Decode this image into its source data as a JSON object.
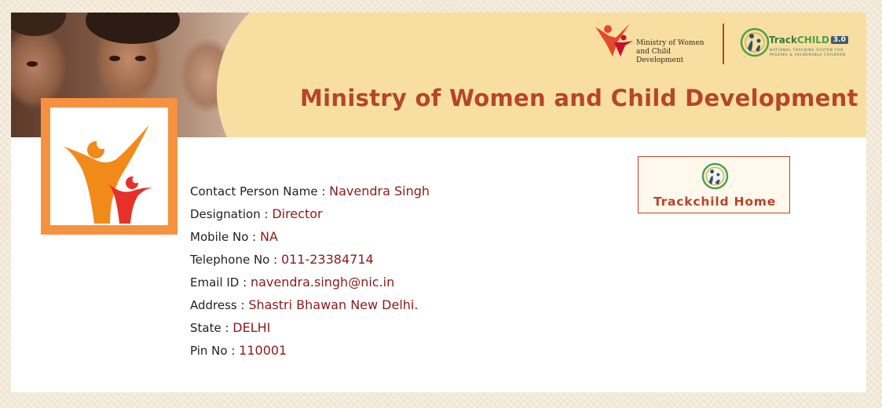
{
  "banner": {
    "title": "Ministry of Women and Child Development",
    "ministry_logo_text_line1": "Ministry of Women",
    "ministry_logo_text_line2": "and Child Development",
    "track_logo": {
      "name_prefix": "Track",
      "name_suffix": "CHILD",
      "version": "3.0",
      "subtitle_line1": "NATIONAL TRACKING SYSTEM FOR",
      "subtitle_line2": "MISSING & VULNERABLE CHILDREN"
    }
  },
  "contact": {
    "name_label": "Contact Person Name : ",
    "name_value": "Navendra Singh",
    "designation_label": "Designation : ",
    "designation_value": "Director",
    "mobile_label": "Mobile No : ",
    "mobile_value": "NA",
    "telephone_label": "Telephone No : ",
    "telephone_value": "011-23384714",
    "email_label": "Email ID : ",
    "email_value": "navendra.singh@nic.in",
    "address_label": "Address : ",
    "address_value": "Shastri Bhawan New Delhi.",
    "state_label": "State : ",
    "state_value": "DELHI",
    "pin_label": "Pin No : ",
    "pin_value": "110001"
  },
  "home_button": {
    "label": "Trackchild Home",
    "icon": "trackchild-emblem-icon"
  },
  "colors": {
    "banner_bg": "#f8dfa1",
    "title": "#b6452a",
    "value_text": "#8b1a1a",
    "logo_frame": "#f6923f"
  }
}
